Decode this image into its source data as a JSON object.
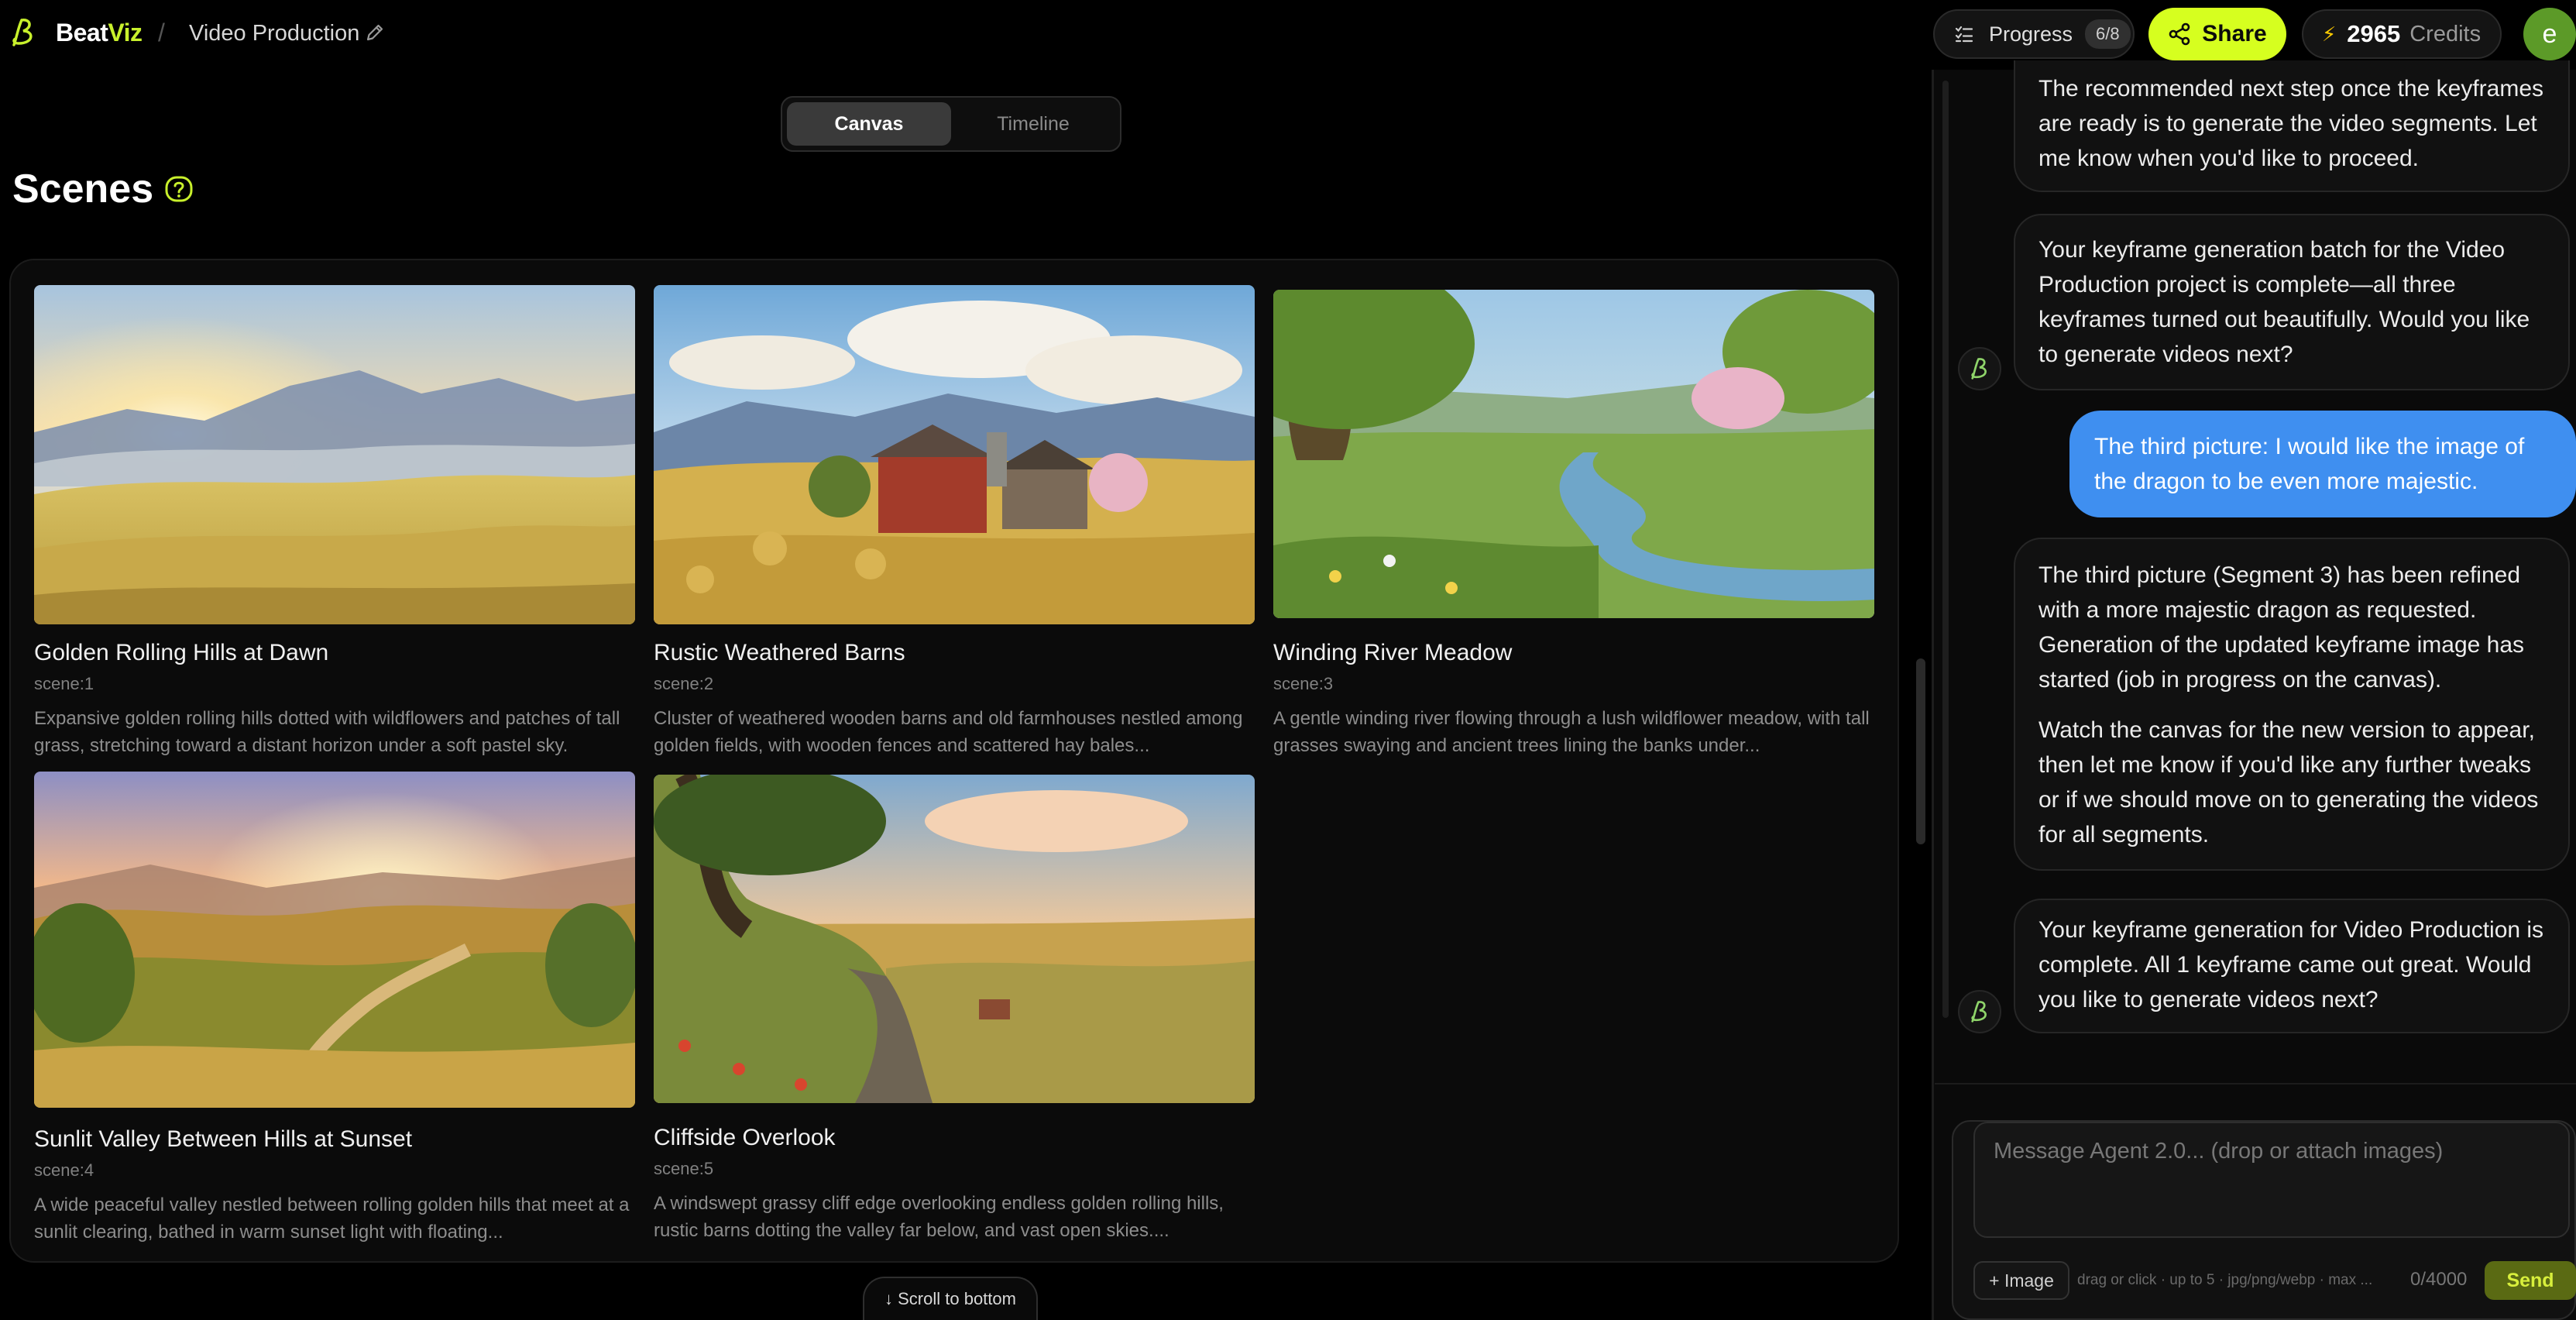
{
  "header": {
    "brand_beat": "Beat",
    "brand_viz": "Viz",
    "separator": "/",
    "project_name": "Video Production",
    "progress_label": "Progress",
    "progress_count": "6/8",
    "share_label": "Share",
    "credits_value": "2965",
    "credits_label": "Credits",
    "avatar_initial": "e"
  },
  "view_toggle": {
    "canvas": "Canvas",
    "timeline": "Timeline",
    "active": "canvas"
  },
  "scenes": {
    "title": "Scenes",
    "items": [
      {
        "title": "Golden Rolling Hills at Dawn",
        "id": "scene:1",
        "desc": "Expansive golden rolling hills dotted with wildflowers and patches of tall grass, stretching toward a distant horizon under a soft pastel sky."
      },
      {
        "title": "Rustic Weathered Barns",
        "id": "scene:2",
        "desc": "Cluster of weathered wooden barns and old farmhouses nestled among golden fields, with wooden fences and scattered hay bales..."
      },
      {
        "title": "Winding River Meadow",
        "id": "scene:3",
        "desc": "A gentle winding river flowing through a lush wildflower meadow, with tall grasses swaying and ancient trees lining the banks under..."
      },
      {
        "title": "Sunlit Valley Between Hills at Sunset",
        "id": "scene:4",
        "desc": "A wide peaceful valley nestled between rolling golden hills that meet at a sunlit clearing, bathed in warm sunset light with floating..."
      },
      {
        "title": "Cliffside Overlook",
        "id": "scene:5",
        "desc": "A windswept grassy cliff edge overlooking endless golden rolling hills, rustic barns dotting the valley far below, and vast open skies...."
      }
    ],
    "scroll_to_bottom": "↓ Scroll to bottom"
  },
  "chat": {
    "messages": [
      {
        "role": "agent",
        "paragraphs": [
          "The recommended next step once the keyframes are ready is to generate the video segments. Let me know when you'd like to proceed."
        ]
      },
      {
        "role": "agent",
        "paragraphs": [
          "Your keyframe generation batch for the Video Production project is complete—all three keyframes turned out beautifully. Would you like to generate videos next?"
        ]
      },
      {
        "role": "user",
        "paragraphs": [
          "The third picture: I would like the image of the dragon to be even more majestic."
        ]
      },
      {
        "role": "agent",
        "paragraphs": [
          "The third picture (Segment 3) has been refined with a more majestic dragon as requested. Generation of the updated keyframe image has started (job in progress on the canvas).",
          "Watch the canvas for the new version to appear, then let me know if you'd like any further tweaks or if we should move on to generating the videos for all segments."
        ]
      },
      {
        "role": "agent",
        "paragraphs": [
          "Your keyframe generation for Video Production is complete. All 1 keyframe came out great. Would you like to generate videos next?"
        ]
      }
    ],
    "composer": {
      "placeholder": "Message Agent 2.0... (drop or attach images)",
      "image_button": "+ Image",
      "hint": "drag or click · up to 5 · jpg/png/webp · max ...",
      "char_count": "0/4000",
      "send": "Send"
    }
  },
  "colors": {
    "accent": "#d6ff1f",
    "user_bubble": "#3f8ff0",
    "background": "#000000",
    "panel": "#0b0b0b"
  }
}
